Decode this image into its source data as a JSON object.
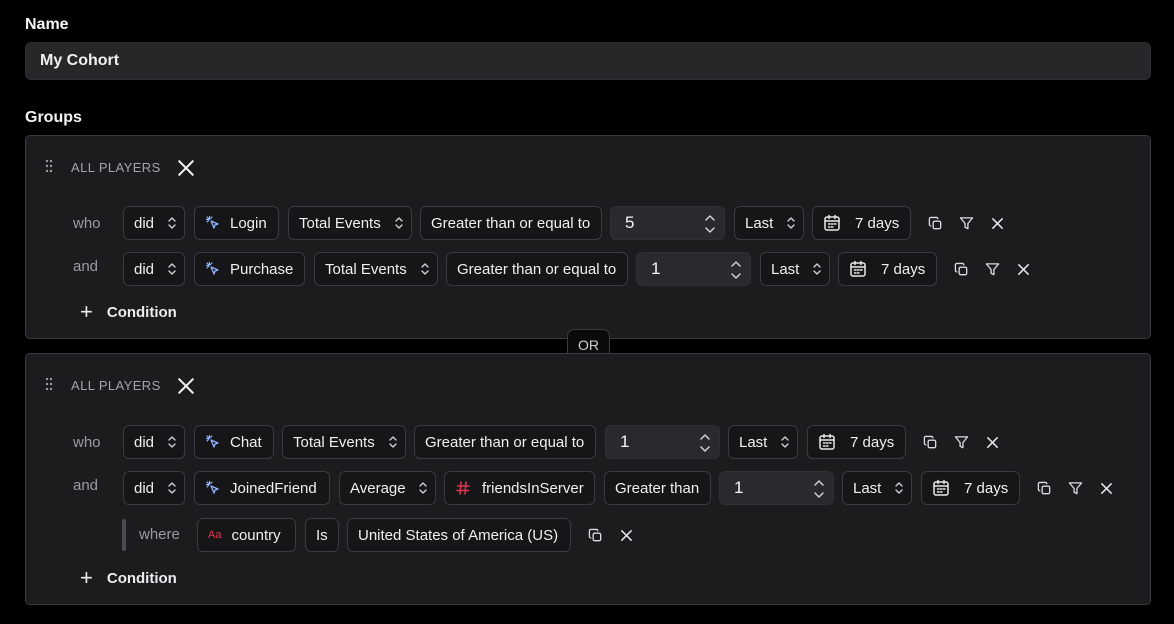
{
  "name": {
    "label": "Name",
    "value": "My Cohort"
  },
  "groups_label": "Groups",
  "or_label": "OR",
  "groups": [
    {
      "header": "ALL PLAYERS",
      "add_condition": "Condition",
      "rows": [
        {
          "conj": "who",
          "did": "did",
          "event": "Login",
          "metric": "Total Events",
          "operator": "Greater than or equal to",
          "value": "5",
          "period": "Last",
          "range": "7 days"
        },
        {
          "conj": "and",
          "did": "did",
          "event": "Purchase",
          "metric": "Total Events",
          "operator": "Greater than or equal to",
          "value": "1",
          "period": "Last",
          "range": "7 days"
        }
      ]
    },
    {
      "header": "ALL PLAYERS",
      "add_condition": "Condition",
      "rows": [
        {
          "conj": "who",
          "did": "did",
          "event": "Chat",
          "metric": "Total Events",
          "operator": "Greater than or equal to",
          "value": "1",
          "period": "Last",
          "range": "7 days"
        },
        {
          "conj": "and",
          "did": "did",
          "event": "JoinedFriend",
          "metric": "Average",
          "property": "friendsInServer",
          "operator": "Greater than",
          "value": "1",
          "period": "Last",
          "range": "7 days"
        }
      ],
      "where": {
        "label": "where",
        "field_icon": "Aa",
        "field": "country",
        "op": "Is",
        "value": "United States of America (US)"
      }
    }
  ],
  "colors": {
    "event_icon": "#8fb4ff",
    "property_hash": "#e0364f",
    "text_icon": "#e0364f"
  }
}
